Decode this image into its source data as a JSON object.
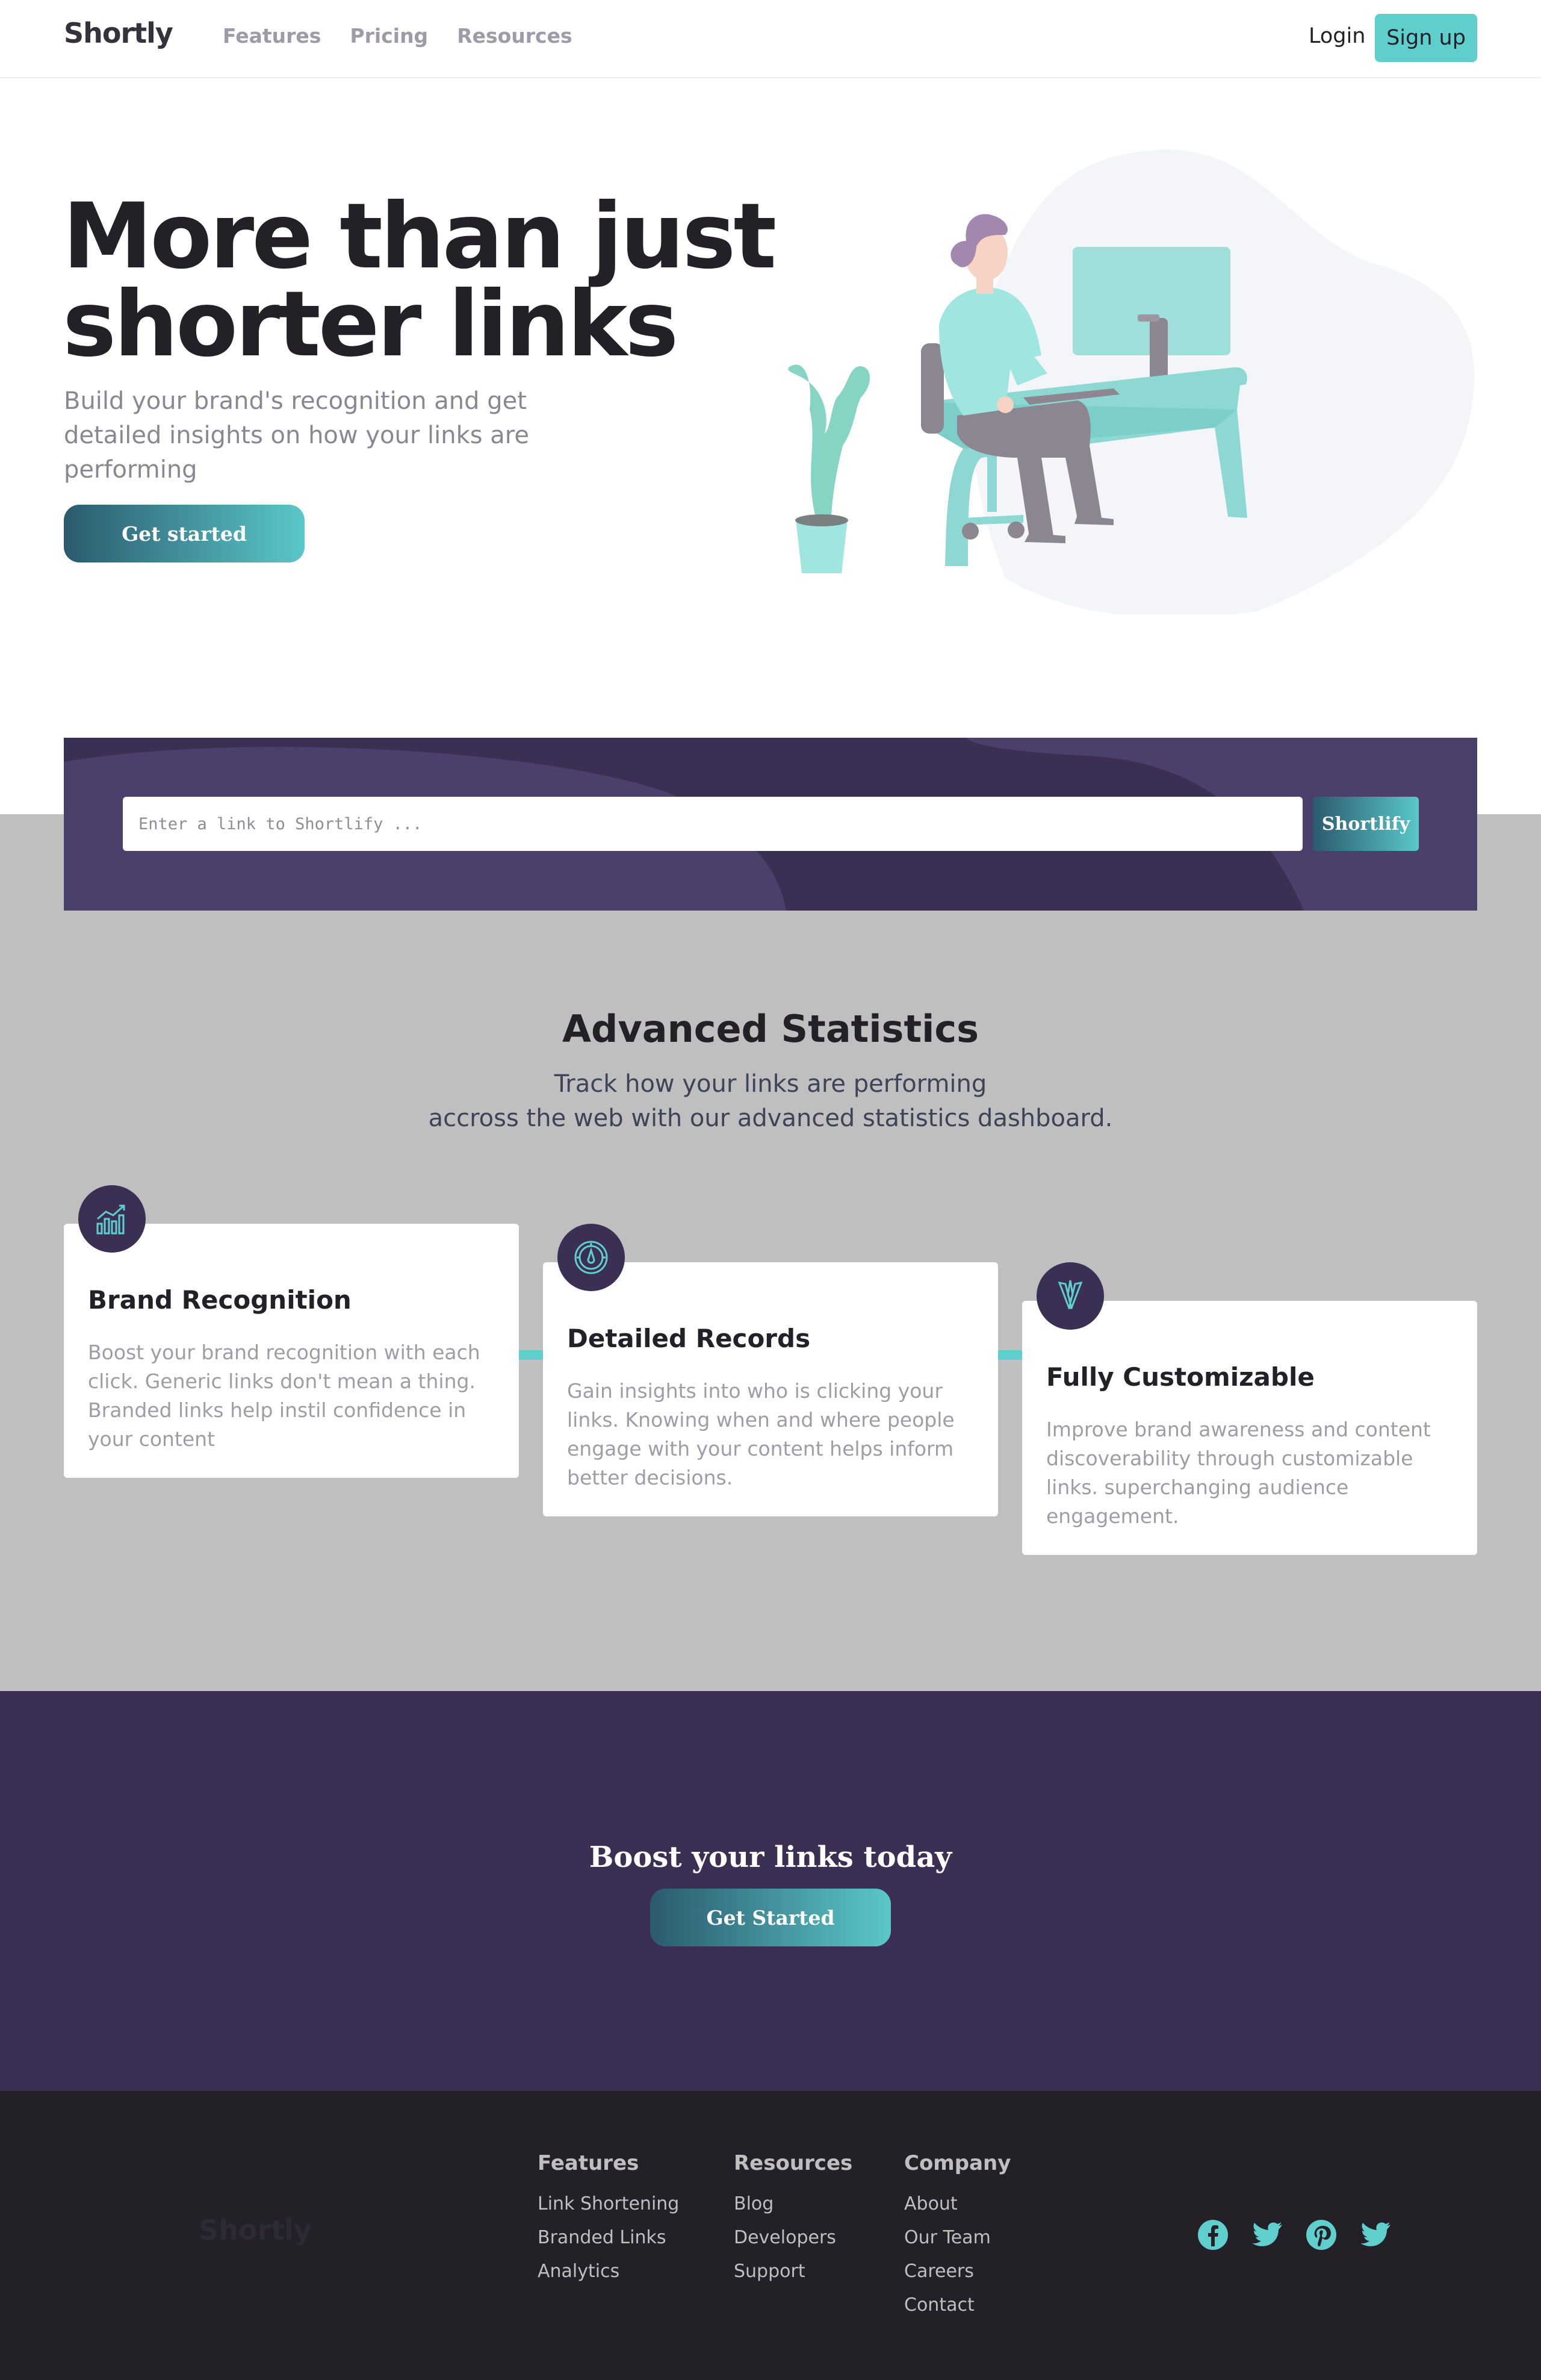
{
  "header": {
    "logo": "Shortly",
    "nav": [
      "Features",
      "Pricing",
      "Resources"
    ],
    "login": "Login",
    "signup": "Sign up"
  },
  "hero": {
    "title": "More than just shorter links",
    "subtitle": "Build your brand's recognition and get detailed insights on how your links are performing",
    "cta": "Get started"
  },
  "shorten": {
    "placeholder": "Enter a link to Shortlify ...",
    "button": "Shortlify"
  },
  "stats": {
    "title": "Advanced Statistics",
    "subtitle_line1": "Track how your links are performing",
    "subtitle_line2": "accross the web with our advanced statistics dashboard.",
    "cards": [
      {
        "icon": "chart-bars-icon",
        "title": "Brand Recognition",
        "text": "Boost your brand recognition with each click. Generic links don't mean a thing. Branded links help instil confidence in your content"
      },
      {
        "icon": "gauge-icon",
        "title": "Detailed Records",
        "text": "Gain insights into who is clicking your links. Knowing when and where people engage with your content helps inform better decisions."
      },
      {
        "icon": "brush-pens-icon",
        "title": "Fully Customizable",
        "text": "Improve brand awareness and content discoverability through customizable links. superchanging audience engagement."
      }
    ]
  },
  "boost": {
    "title": "Boost your links today",
    "cta": "Get Started"
  },
  "footer": {
    "logo": "Shortly",
    "columns": [
      {
        "title": "Features",
        "links": [
          "Link Shortening",
          "Branded Links",
          "Analytics"
        ]
      },
      {
        "title": "Resources",
        "links": [
          "Blog",
          "Developers",
          "Support"
        ]
      },
      {
        "title": "Company",
        "links": [
          "About",
          "Our Team",
          "Careers",
          "Contact"
        ]
      }
    ],
    "social": [
      "facebook-icon",
      "twitter-icon",
      "pinterest-icon",
      "twitter-icon"
    ]
  },
  "colors": {
    "accent": "#5fcfcd",
    "dark_violet": "#3b3054",
    "shorten_bg": "#4b3f6b",
    "grey_band": "#bfbfbf",
    "footer_bg": "#232127"
  }
}
